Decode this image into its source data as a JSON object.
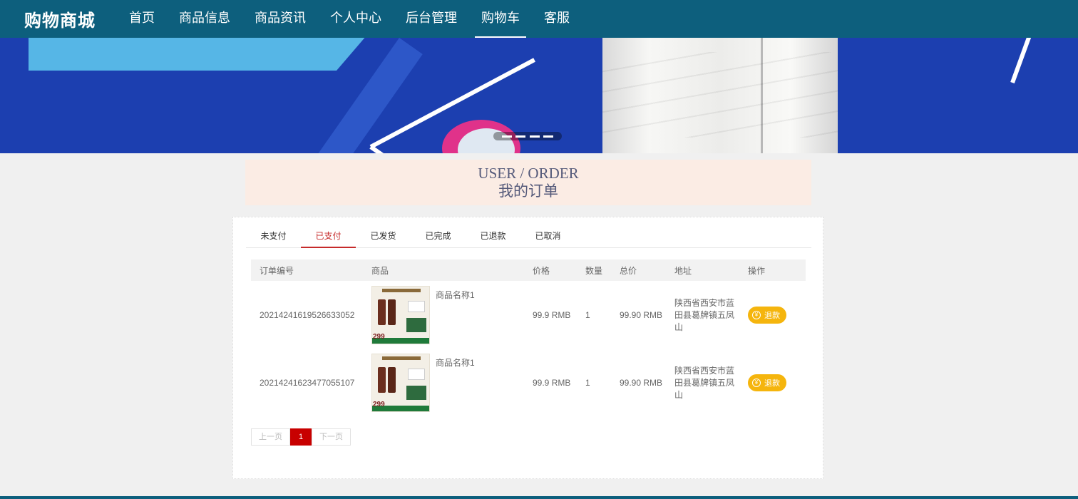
{
  "brand": "购物商城",
  "nav": [
    {
      "label": "首页"
    },
    {
      "label": "商品信息"
    },
    {
      "label": "商品资讯"
    },
    {
      "label": "个人中心"
    },
    {
      "label": "后台管理"
    },
    {
      "label": "购物车"
    },
    {
      "label": "客服"
    }
  ],
  "nav_active": "购物车",
  "title": {
    "en": "USER / ORDER",
    "cn": "我的订单"
  },
  "tabs": [
    "未支付",
    "已支付",
    "已发货",
    "已完成",
    "已退款",
    "已取消"
  ],
  "active_tab": "已支付",
  "table": {
    "headers": [
      "订单编号",
      "商品",
      "价格",
      "数量",
      "总价",
      "地址",
      "操作"
    ],
    "rows": [
      {
        "order_no": "20214241619526633052",
        "product_name": "商品名称1",
        "product_img_text": "299",
        "price": "99.9 RMB",
        "qty": "1",
        "total": "99.90 RMB",
        "address": "陕西省西安市蓝田县葛牌镇五凤山",
        "action": "退款"
      },
      {
        "order_no": "20214241623477055107",
        "product_name": "商品名称1",
        "product_img_text": "299",
        "price": "99.9 RMB",
        "qty": "1",
        "total": "99.90 RMB",
        "address": "陕西省西安市蓝田县葛牌镇五凤山",
        "action": "退款"
      }
    ]
  },
  "pager": {
    "prev": "上一页",
    "current": "1",
    "next": "下一页"
  },
  "banner": {
    "slide_count": 4
  },
  "colors": {
    "header": "#0d5f7d",
    "accent_red": "#c62a2a",
    "refund": "#f5b50d",
    "title_bg": "#fbece4"
  }
}
